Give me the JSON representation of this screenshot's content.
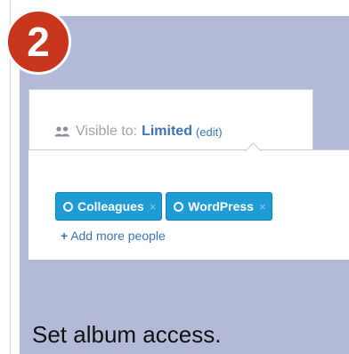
{
  "step": {
    "number": "2"
  },
  "visibility": {
    "label": "Visible to:",
    "value": "Limited",
    "edit_label": "(edit)"
  },
  "share": {
    "chips": [
      {
        "label": "Colleagues",
        "remove": "×"
      },
      {
        "label": "WordPress",
        "remove": "×"
      }
    ],
    "add_more_plus": "+",
    "add_more_label": "Add more people"
  },
  "caption": "Set album access.",
  "colors": {
    "badge": "#c8371d",
    "panel_background": "#b3bad8",
    "chip": "#1f9bd6",
    "link": "#3b73b8"
  },
  "icons": {
    "visibility": "people-icon",
    "chip": "circle-icon",
    "remove": "close-icon"
  }
}
